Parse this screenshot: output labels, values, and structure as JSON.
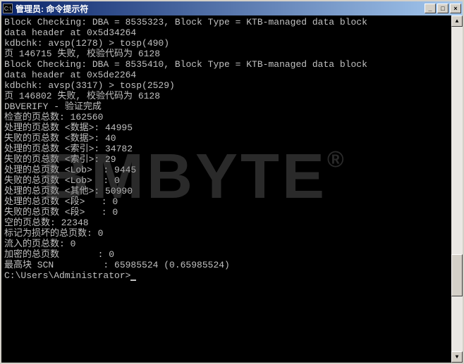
{
  "window": {
    "title": "管理员: 命令提示符",
    "icon_label": "C:\\"
  },
  "watermark": "BMBYTE",
  "lines": [
    "Block Checking: DBA = 8535323, Block Type = KTB-managed data block",
    "data header at 0x5d34264",
    "kdbchk: avsp(1278) > tosp(490)",
    "页 146715 失败, 校验代码为 6128",
    "Block Checking: DBA = 8535410, Block Type = KTB-managed data block",
    "data header at 0x5de2264",
    "kdbchk: avsp(3317) > tosp(2529)",
    "页 146802 失败, 校验代码为 6128",
    "",
    "",
    "DBVERIFY - 验证完成",
    "",
    "检查的页总数: 162560",
    "处理的页总数 <数据>: 44995",
    "失败的页总数 <数据>: 40",
    "处理的页总数 <索引>: 34782",
    "失败的页总数 <索引>: 29",
    "处理的总页数 <Lob>  : 9445",
    "失败的总页数 <Lob>  : 0",
    "处理的总页数 <其他>: 50990",
    "处理的总页数 <段>   : 0",
    "失败的总页数 <段>   : 0",
    "空的页总数: 22348",
    "标记为损坏的总页数: 0",
    "流入的页总数: 0",
    "加密的总页数       : 0",
    "最高块 SCN         : 65985524 (0.65985524)",
    ""
  ],
  "prompt": "C:\\Users\\Administrator>"
}
